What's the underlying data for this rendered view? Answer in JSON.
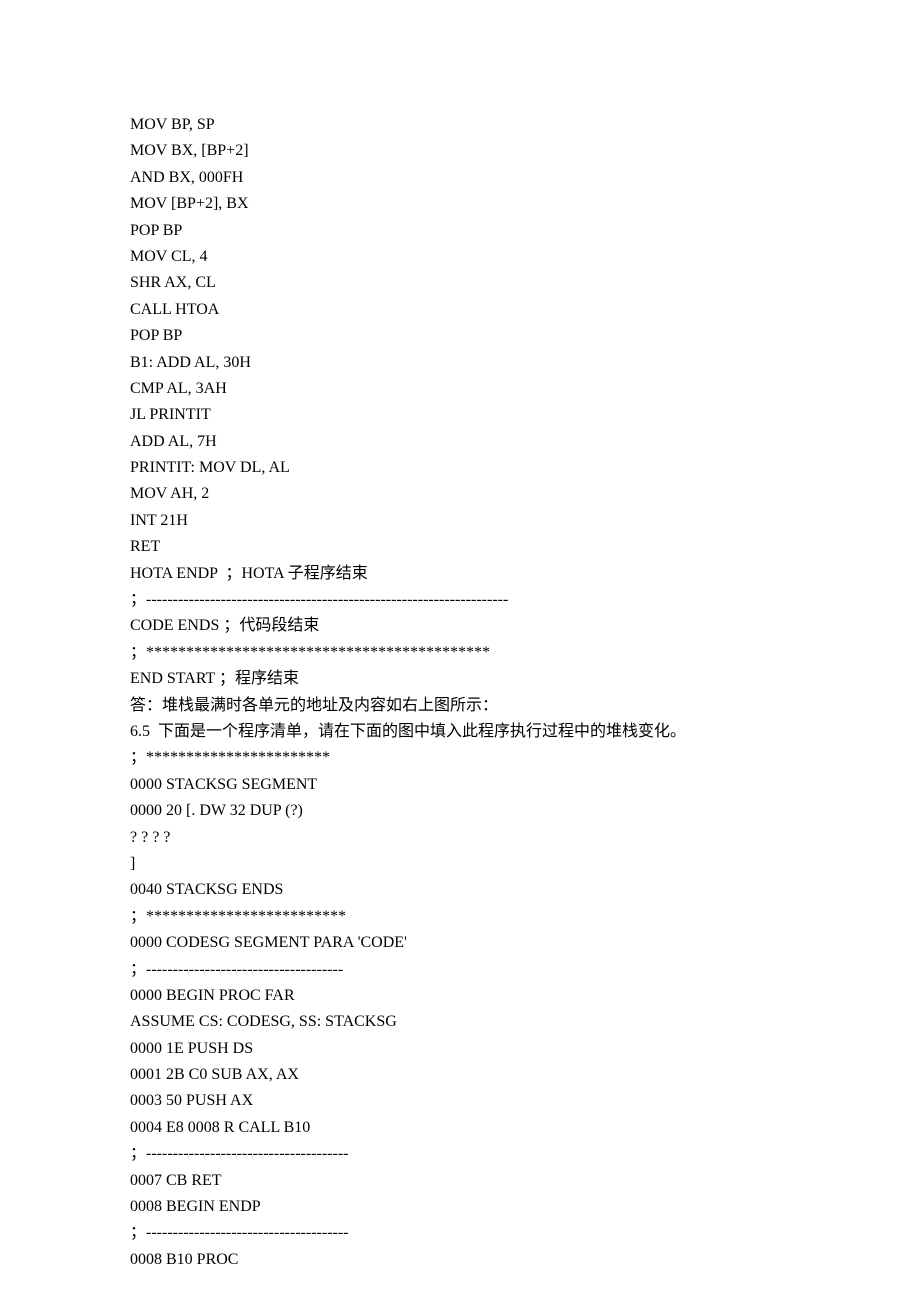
{
  "lines": [
    "MOV BP, SP",
    "MOV BX, [BP+2]",
    "AND BX, 000FH",
    "MOV [BP+2], BX",
    "POP BP",
    "MOV CL, 4",
    "SHR AX, CL",
    "CALL HTOA",
    "POP BP",
    "B1: ADD AL, 30H",
    "CMP AL, 3AH",
    "JL PRINTIT",
    "ADD AL, 7H",
    "PRINTIT: MOV DL, AL",
    "MOV AH, 2",
    "INT 21H",
    "RET",
    "HOTA ENDP  ；HOTA 子程序结束",
    "；--------------------------------------------------------------------",
    "CODE ENDS ；代码段结束",
    "；*******************************************",
    "END START ；程序结束",
    "答：堆栈最满时各单元的地址及内容如右上图所示：",
    "6.5  下面是一个程序清单，请在下面的图中填入此程序执行过程中的堆栈变化。",
    "；***********************",
    "0000 STACKSG SEGMENT",
    "0000 20 [. DW 32 DUP (?)",
    "? ? ? ?",
    "]",
    "0040 STACKSG ENDS",
    "；*************************",
    "0000 CODESG SEGMENT PARA 'CODE'",
    "；-------------------------------------",
    "0000 BEGIN PROC FAR",
    "ASSUME CS: CODESG, SS: STACKSG",
    "0000 1E PUSH DS",
    "0001 2B C0 SUB AX, AX",
    "0003 50 PUSH AX",
    "0004 E8 0008 R CALL B10",
    "；--------------------------------------",
    "0007 CB RET",
    "0008 BEGIN ENDP",
    "；--------------------------------------",
    "0008 B10 PROC"
  ]
}
